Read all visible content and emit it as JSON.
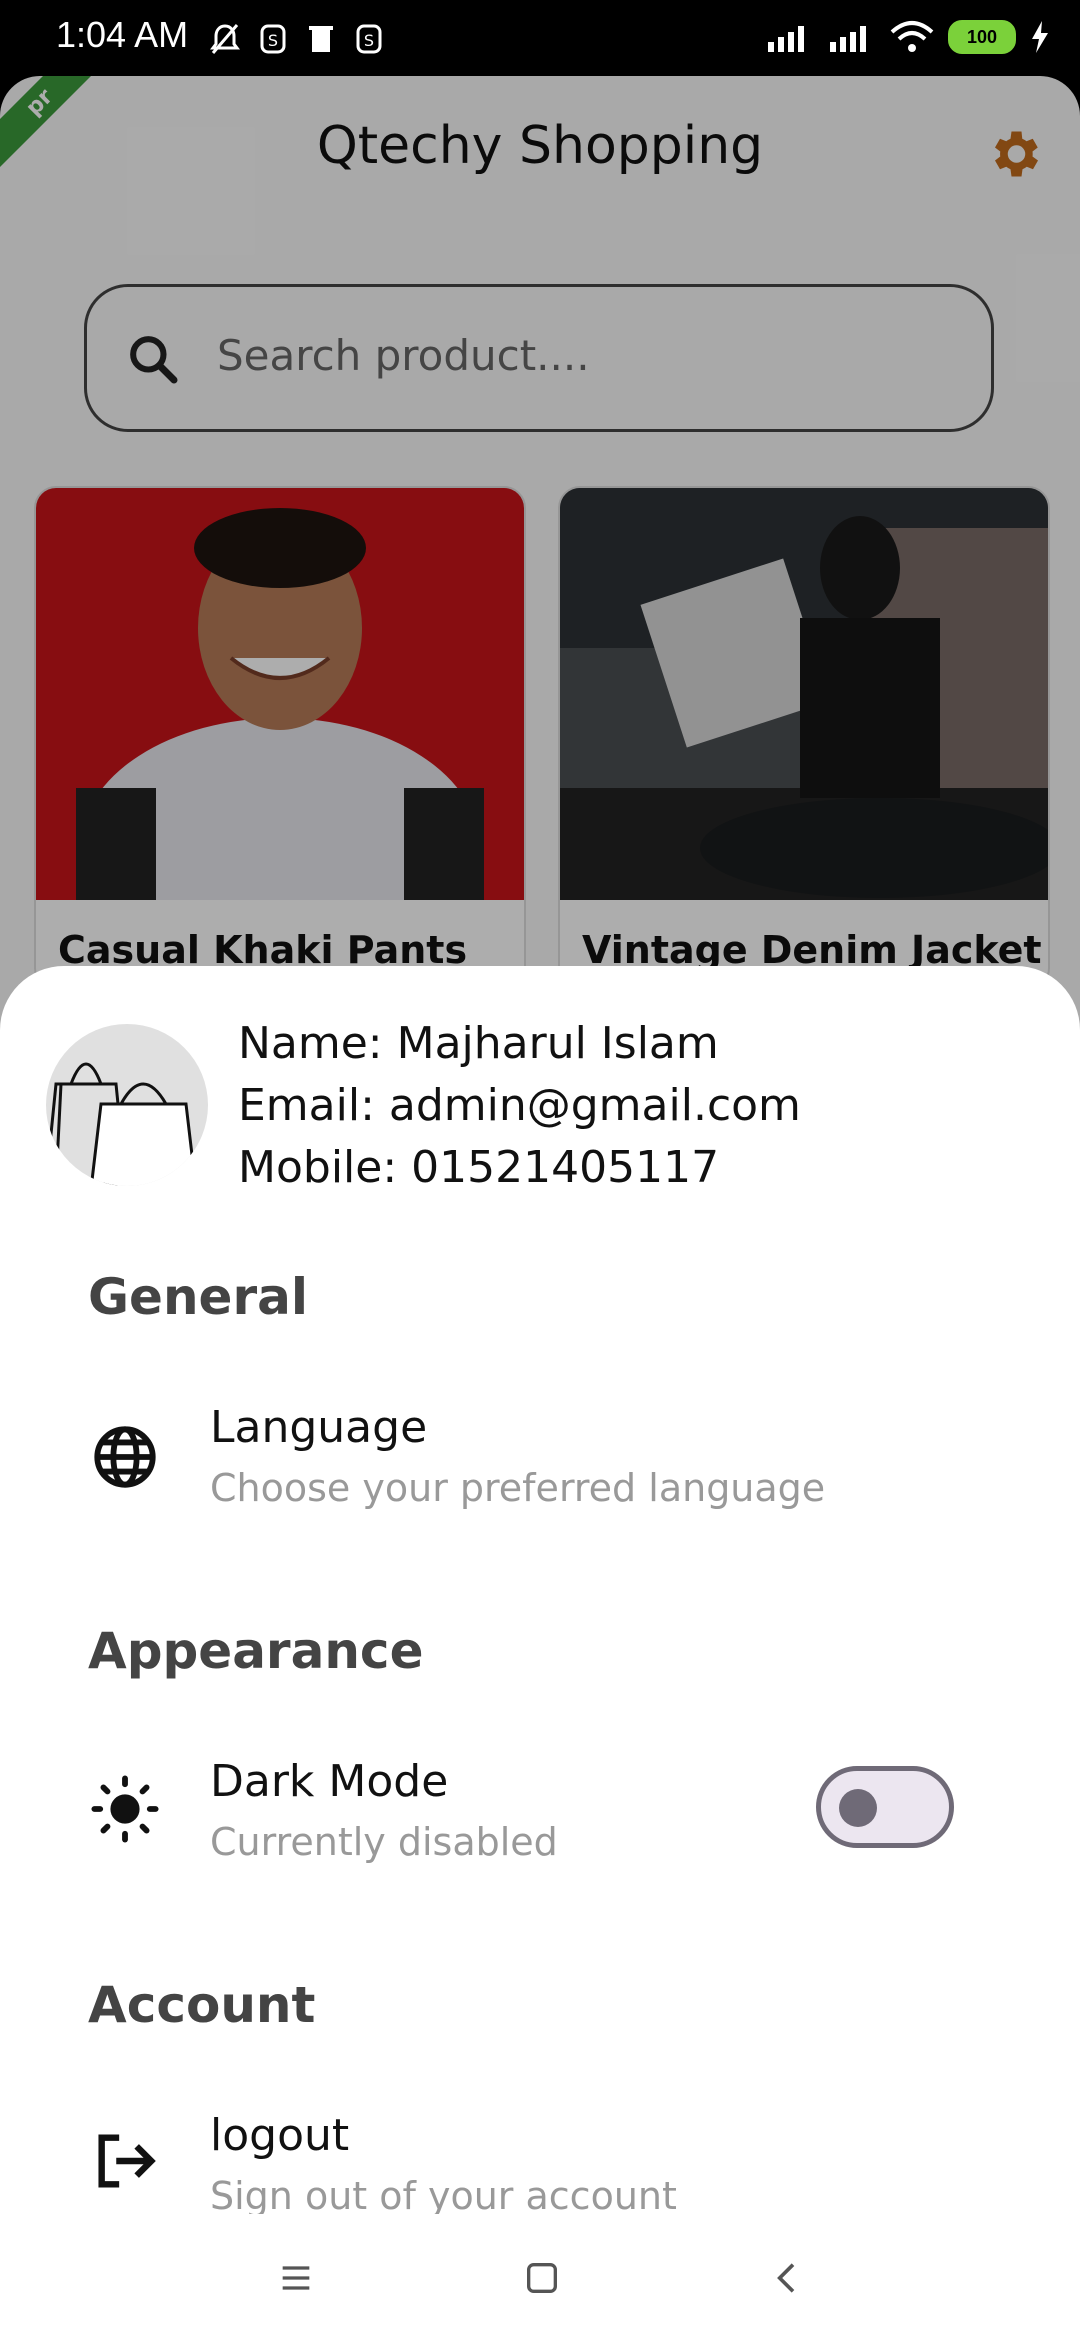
{
  "status": {
    "time": "1:04 AM",
    "battery": "100"
  },
  "app": {
    "title": "Qtechy Shopping",
    "banner": "pr",
    "search_placeholder": "Search product...."
  },
  "products": [
    {
      "name": "Casual Khaki Pants"
    },
    {
      "name": "Vintage Denim Jacket"
    }
  ],
  "profile": {
    "name": "Name: Majharul Islam",
    "email": "Email: admin@gmail.com",
    "mobile": "Mobile: 01521405117"
  },
  "sections": {
    "general": "General",
    "appearance": "Appearance",
    "account": "Account"
  },
  "items": {
    "language_title": "Language",
    "language_sub": "Choose your preferred language",
    "dark_title": "Dark Mode",
    "dark_sub": "Currently disabled",
    "logout_title": "logout",
    "logout_sub": "Sign out of your account"
  },
  "toggle_state": "off",
  "colors": {
    "accent_gear": "#c06a1c",
    "banner": "#3b9a3b",
    "battery": "#7bd13a"
  }
}
